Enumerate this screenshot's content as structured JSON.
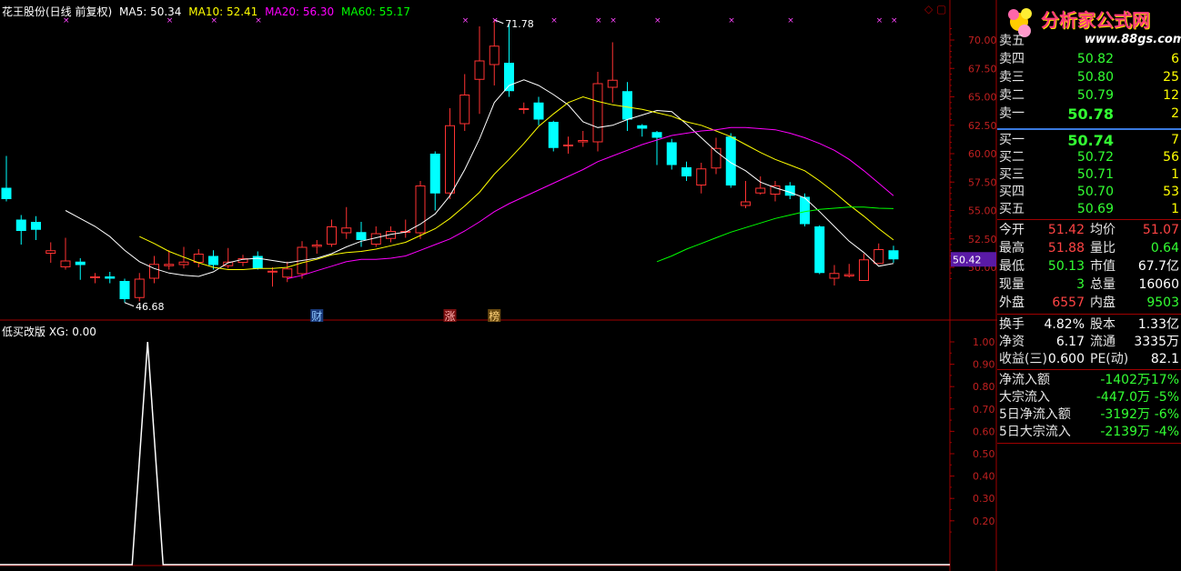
{
  "header": {
    "stock": "花王股份(日线 前复权)",
    "ma5": "MA5: 50.34",
    "ma10": "MA10: 52.41",
    "ma20": "MA20: 56.30",
    "ma60": "MA60: 55.17",
    "indicator": "低买改版 XG: 0.00",
    "max_label": "71.78",
    "min_label": "46.68",
    "current_price": "50.42",
    "events": [
      "财",
      "涨",
      "榜"
    ],
    "corner_icons": "◇ ▢"
  },
  "colors": {
    "up": "#ff3232",
    "down": "#00ffff",
    "ma5": "#ffffff",
    "ma10": "#ffff00",
    "ma20": "#ff00ff",
    "ma60": "#00ff00",
    "axis": "#a00000"
  },
  "chart_data": [
    {
      "type": "candlestick",
      "title": "花王股份(日线 前复权)",
      "ylim": [
        46.0,
        72.0
      ],
      "yticks": [
        50.0,
        52.5,
        55.0,
        57.5,
        60.0,
        62.5,
        65.0,
        67.5,
        70.0
      ],
      "candles": [
        [
          57.0,
          56.0,
          59.8,
          55.8
        ],
        [
          54.2,
          53.2,
          54.6,
          52.0
        ],
        [
          54.0,
          53.3,
          54.5,
          52.4
        ],
        [
          51.2,
          51.5,
          52.2,
          50.4
        ],
        [
          50.0,
          50.6,
          52.6,
          49.8
        ],
        [
          50.5,
          50.2,
          50.8,
          48.9
        ],
        [
          49.1,
          49.2,
          49.5,
          48.6
        ],
        [
          49.2,
          49.0,
          49.6,
          48.6
        ],
        [
          48.8,
          47.2,
          49.0,
          46.9
        ],
        [
          47.3,
          49.0,
          49.5,
          47.0
        ],
        [
          49.0,
          50.3,
          51.0,
          48.6
        ],
        [
          50.1,
          50.3,
          51.5,
          49.8
        ],
        [
          50.2,
          50.5,
          51.8,
          49.9
        ],
        [
          50.4,
          51.2,
          51.6,
          50.0
        ],
        [
          51.0,
          50.2,
          51.5,
          49.8
        ],
        [
          50.1,
          50.5,
          51.7,
          49.9
        ],
        [
          50.4,
          50.8,
          51.1,
          50.1
        ],
        [
          51.0,
          49.9,
          51.4,
          49.8
        ],
        [
          49.6,
          49.7,
          50.0,
          48.3
        ],
        [
          49.1,
          49.9,
          50.5,
          48.7
        ],
        [
          49.4,
          51.8,
          52.3,
          49.0
        ],
        [
          51.8,
          52.0,
          52.4,
          51.2
        ],
        [
          52.0,
          53.6,
          54.2,
          51.8
        ],
        [
          53.0,
          53.5,
          55.3,
          52.5
        ],
        [
          53.1,
          52.4,
          54.0,
          51.8
        ],
        [
          52.0,
          53.0,
          53.6,
          51.8
        ],
        [
          52.5,
          53.2,
          53.6,
          52.2
        ],
        [
          53.2,
          53.2,
          54.2,
          52.6
        ],
        [
          53.0,
          57.2,
          57.6,
          52.5
        ],
        [
          60.0,
          56.5,
          60.2,
          55.0
        ],
        [
          56.5,
          62.5,
          64.0,
          56.0
        ],
        [
          62.6,
          65.2,
          67.0,
          62.0
        ],
        [
          66.5,
          68.2,
          71.2,
          63.5
        ],
        [
          67.8,
          69.5,
          71.78,
          66.0
        ],
        [
          68.0,
          65.5,
          71.5,
          65.0
        ],
        [
          64.0,
          64.0,
          64.5,
          63.5
        ],
        [
          64.5,
          63.0,
          65.0,
          62.5
        ],
        [
          62.8,
          60.5,
          62.9,
          60.2
        ],
        [
          60.8,
          60.8,
          61.5,
          60.0
        ],
        [
          61.0,
          61.2,
          62.0,
          60.6
        ],
        [
          61.0,
          66.2,
          67.2,
          60.2
        ],
        [
          65.8,
          66.5,
          69.8,
          64.5
        ],
        [
          65.5,
          63.0,
          66.3,
          62.0
        ],
        [
          62.5,
          62.2,
          62.6,
          61.5
        ],
        [
          61.9,
          61.4,
          62.0,
          59.0
        ],
        [
          61.0,
          59.0,
          61.3,
          58.6
        ],
        [
          58.8,
          58.0,
          59.3,
          57.6
        ],
        [
          57.2,
          58.7,
          59.2,
          56.5
        ],
        [
          58.7,
          60.5,
          61.4,
          58.2
        ],
        [
          61.5,
          57.2,
          61.8,
          57.0
        ],
        [
          55.4,
          55.8,
          57.6,
          55.2
        ],
        [
          56.5,
          57.0,
          58.0,
          56.4
        ],
        [
          56.4,
          57.2,
          57.6,
          55.8
        ],
        [
          57.2,
          56.3,
          57.5,
          56.0
        ],
        [
          56.2,
          53.8,
          56.5,
          53.6
        ],
        [
          53.6,
          49.5,
          53.7,
          49.4
        ],
        [
          49.0,
          49.5,
          50.2,
          48.4
        ],
        [
          49.2,
          49.4,
          50.3,
          49.1
        ],
        [
          48.8,
          50.7,
          51.2,
          48.8
        ],
        [
          50.3,
          51.6,
          52.1,
          50.3
        ],
        [
          51.5,
          50.7,
          51.9,
          50.4
        ]
      ],
      "series": [
        {
          "name": "MA5",
          "values": [
            null,
            null,
            null,
            null,
            55.0,
            54.3,
            53.6,
            52.7,
            51.5,
            50.5,
            49.9,
            49.5,
            49.3,
            49.2,
            49.6,
            50.4,
            50.7,
            50.8,
            50.6,
            50.4,
            50.6,
            50.8,
            51.2,
            51.8,
            52.3,
            52.6,
            52.9,
            53.1,
            53.8,
            54.7,
            56.3,
            58.6,
            61.3,
            64.5,
            66.0,
            66.5,
            66.0,
            65.2,
            64.3,
            62.8,
            62.3,
            62.5,
            63.0,
            63.4,
            63.8,
            63.7,
            62.6,
            61.4,
            60.2,
            59.2,
            58.5,
            57.5,
            57.0,
            56.6,
            56.1,
            54.9,
            53.6,
            52.3,
            51.3,
            50.1,
            50.34
          ]
        },
        {
          "name": "MA10",
          "values": [
            null,
            null,
            null,
            null,
            null,
            null,
            null,
            null,
            null,
            52.7,
            52.1,
            51.4,
            50.9,
            50.4,
            50.0,
            49.8,
            49.8,
            49.9,
            49.9,
            50.0,
            50.4,
            50.7,
            51.1,
            51.3,
            51.4,
            51.6,
            51.9,
            52.2,
            52.8,
            53.4,
            54.3,
            55.4,
            56.6,
            58.2,
            59.5,
            60.9,
            62.4,
            63.5,
            64.5,
            65.0,
            64.6,
            64.3,
            64.1,
            63.9,
            63.6,
            63.3,
            62.8,
            62.5,
            62.0,
            61.5,
            60.8,
            60.1,
            59.5,
            59.0,
            58.5,
            57.6,
            56.6,
            55.5,
            54.5,
            53.4,
            52.41
          ]
        },
        {
          "name": "MA20",
          "values": [
            null,
            null,
            null,
            null,
            null,
            null,
            null,
            null,
            null,
            null,
            null,
            null,
            null,
            null,
            null,
            null,
            null,
            null,
            null,
            49.0,
            49.3,
            49.7,
            50.1,
            50.5,
            50.7,
            50.7,
            50.8,
            51.0,
            51.5,
            52.0,
            52.5,
            53.2,
            54.0,
            54.9,
            55.6,
            56.2,
            56.8,
            57.4,
            58.0,
            58.6,
            59.3,
            59.8,
            60.3,
            60.8,
            61.2,
            61.6,
            61.8,
            62.0,
            62.1,
            62.3,
            62.3,
            62.2,
            62.1,
            61.8,
            61.4,
            60.9,
            60.3,
            59.5,
            58.5,
            57.4,
            56.3
          ]
        },
        {
          "name": "MA60",
          "values": [
            null,
            null,
            null,
            null,
            null,
            null,
            null,
            null,
            null,
            null,
            null,
            null,
            null,
            null,
            null,
            null,
            null,
            null,
            null,
            null,
            null,
            null,
            null,
            null,
            null,
            null,
            null,
            null,
            null,
            null,
            null,
            null,
            null,
            null,
            null,
            null,
            null,
            null,
            null,
            null,
            null,
            null,
            null,
            null,
            50.5,
            51.0,
            51.6,
            52.1,
            52.6,
            53.1,
            53.5,
            53.9,
            54.3,
            54.6,
            54.9,
            55.1,
            55.2,
            55.3,
            55.3,
            55.2,
            55.17
          ]
        }
      ]
    },
    {
      "type": "line",
      "title": "低买改版 XG: 0.00",
      "ylim": [
        0,
        1.05
      ],
      "yticks": [
        0.2,
        0.3,
        0.4,
        0.5,
        0.6,
        0.7,
        0.8,
        0.9,
        1.0
      ],
      "series": [
        {
          "name": "XG",
          "values": [
            0,
            0,
            0,
            0,
            0,
            0,
            0,
            0,
            0,
            1,
            0,
            0,
            0,
            0,
            0,
            0,
            0,
            0,
            0,
            0,
            0,
            0,
            0,
            0,
            0,
            0,
            0,
            0,
            0,
            0,
            0,
            0,
            0,
            0,
            0,
            0,
            0,
            0,
            0,
            0,
            0,
            0,
            0,
            0,
            0,
            0,
            0,
            0,
            0,
            0,
            0,
            0,
            0,
            0,
            0,
            0,
            0,
            0,
            0,
            0,
            0
          ]
        }
      ]
    }
  ],
  "logo": {
    "brand": "分析家公式网",
    "url": "www.88gs.com"
  },
  "quote": {
    "asks": [
      {
        "label": "卖五",
        "price": "",
        "vol": ""
      },
      {
        "label": "卖四",
        "price": "50.82",
        "vol": "6"
      },
      {
        "label": "卖三",
        "price": "50.80",
        "vol": "25"
      },
      {
        "label": "卖二",
        "price": "50.79",
        "vol": "12"
      },
      {
        "label": "卖一",
        "price": "50.78",
        "vol": "2"
      }
    ],
    "bids": [
      {
        "label": "买一",
        "price": "50.74",
        "vol": "7"
      },
      {
        "label": "买二",
        "price": "50.72",
        "vol": "56"
      },
      {
        "label": "买三",
        "price": "50.71",
        "vol": "1"
      },
      {
        "label": "买四",
        "price": "50.70",
        "vol": "53"
      },
      {
        "label": "买五",
        "price": "50.69",
        "vol": "1"
      }
    ],
    "stats": [
      {
        "l1": "今开",
        "v1": "51.42",
        "c1": "red",
        "l2": "均价",
        "v2": "51.07",
        "c2": "red"
      },
      {
        "l1": "最高",
        "v1": "51.88",
        "c1": "red",
        "l2": "量比",
        "v2": "0.64",
        "c2": "green"
      },
      {
        "l1": "最低",
        "v1": "50.13",
        "c1": "green",
        "l2": "市值",
        "v2": "67.7亿",
        "c2": "white"
      },
      {
        "l1": "现量",
        "v1": "3",
        "c1": "green",
        "l2": "总量",
        "v2": "16060",
        "c2": "white"
      },
      {
        "l1": "外盘",
        "v1": "6557",
        "c1": "red",
        "l2": "内盘",
        "v2": "9503",
        "c2": "green"
      }
    ],
    "stats2": [
      {
        "l1": "换手",
        "v1": "4.82%",
        "c1": "white",
        "l2": "股本",
        "v2": "1.33亿",
        "c2": "white"
      },
      {
        "l1": "净资",
        "v1": "6.17",
        "c1": "white",
        "l2": "流通",
        "v2": "3335万",
        "c2": "white"
      },
      {
        "l1": "收益(三)",
        "v1": "0.600",
        "c1": "white",
        "l2": "PE(动)",
        "v2": "82.1",
        "c2": "white"
      }
    ],
    "flows": [
      {
        "label": "净流入额",
        "value": "-1402万",
        "pct": "-17%"
      },
      {
        "label": "大宗流入",
        "value": "-447.0万",
        "pct": "-5%"
      },
      {
        "label": "5日净流入额",
        "value": "-3192万",
        "pct": "-6%"
      },
      {
        "label": "5日大宗流入",
        "value": "-2139万",
        "pct": "-4%"
      }
    ]
  }
}
